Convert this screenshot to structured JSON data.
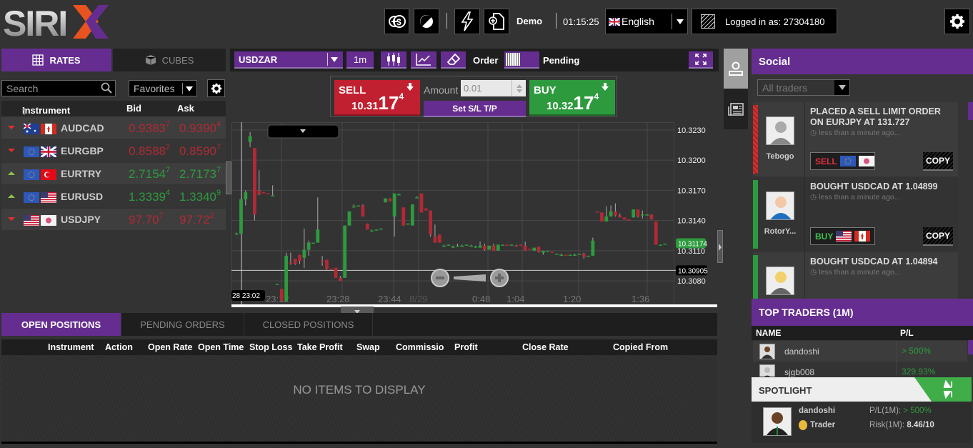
{
  "app": {
    "name": "SIRIX"
  },
  "topbar": {
    "mode": "Demo",
    "clock": "01:15:25",
    "language": "English",
    "logged_in": "Logged in as: 27304180",
    "buttons": [
      "deposit-icon",
      "theme-icon",
      "flash-icon",
      "new-document-icon"
    ]
  },
  "rates": {
    "tabs": {
      "rates": "RATES",
      "cubes": "CUBES"
    },
    "search_placeholder": "Search",
    "filter": "Favorites",
    "columns": {
      "instrument": "Instrument",
      "bid": "Bid",
      "ask": "Ask"
    },
    "rows": [
      {
        "symbol": "AUDCAD",
        "dir": "down",
        "bid": "0.9383",
        "bid_pip": "7",
        "ask": "0.9390",
        "ask_pip": "4",
        "flags": [
          "au",
          "ca"
        ]
      },
      {
        "symbol": "EURGBP",
        "dir": "down",
        "bid": "0.8588",
        "bid_pip": "2",
        "ask": "0.8590",
        "ask_pip": "7",
        "flags": [
          "eu",
          "gb"
        ]
      },
      {
        "symbol": "EURTRY",
        "dir": "up",
        "bid": "2.7154",
        "bid_pip": "7",
        "ask": "2.7173",
        "ask_pip": "7",
        "flags": [
          "eu",
          "tr"
        ]
      },
      {
        "symbol": "EURUSD",
        "dir": "up",
        "bid": "1.3339",
        "bid_pip": "4",
        "ask": "1.3340",
        "ask_pip": "9",
        "flags": [
          "eu",
          "us"
        ]
      },
      {
        "symbol": "USDJPY",
        "dir": "down",
        "bid": "97.70",
        "bid_pip": "7",
        "ask": "97.72",
        "ask_pip": "2",
        "flags": [
          "us",
          "jp"
        ]
      }
    ]
  },
  "chart_toolbar": {
    "symbol": "USDZAR",
    "timeframe": "1m",
    "order_label": "Order",
    "pending_label": "Pending"
  },
  "trade": {
    "sell_label": "SELL",
    "sell_price_main": "10.31",
    "sell_price_big": "17",
    "sell_price_pip": "4",
    "buy_label": "BUY",
    "buy_price_main": "10.32",
    "buy_price_big": "17",
    "buy_price_pip": "4",
    "amount_label": "Amount",
    "amount_value": "0.01",
    "sltp_label": "Set S/L T/P"
  },
  "chart_data": {
    "type": "candlestick",
    "symbol": "USDZAR",
    "y_ticks": [
      "10.3230",
      "10.3200",
      "10.3170",
      "10.3140",
      "10.3110",
      "10.3080"
    ],
    "ylim": [
      10.3068,
      10.3242
    ],
    "x_ticks": [
      "23:12",
      "23:28",
      "23:44",
      "8/29",
      "0:48",
      "1:04",
      "1:20",
      "1:36"
    ],
    "current_price": "10.31174",
    "crosshair_price": "10.30905",
    "crosshair_time": "28 23:02",
    "candles": [
      [
        10.3127,
        10.3128,
        10.3126,
        10.3127
      ],
      [
        10.3127,
        10.3162,
        10.3127,
        10.3161
      ],
      [
        10.3161,
        10.317,
        10.3155,
        10.3168
      ],
      [
        10.3218,
        10.3228,
        10.3213,
        10.3224
      ],
      [
        10.3212,
        10.3212,
        10.314,
        10.3146
      ],
      [
        10.317,
        10.319,
        10.3165,
        10.3166
      ],
      [
        10.3168,
        10.3168,
        10.3167,
        10.3167
      ],
      [
        10.3167,
        10.3167,
        10.3166,
        10.3166
      ],
      [
        10.3165,
        10.3175,
        10.3165,
        10.3165
      ],
      [
        10.3077,
        10.3077,
        10.3077,
        10.3077
      ],
      [
        10.3072,
        10.3072,
        10.306,
        10.306
      ],
      [
        10.306,
        10.3108,
        10.306,
        10.3105
      ],
      [
        10.3098,
        10.3108,
        10.3096,
        10.3097
      ],
      [
        10.3102,
        10.3102,
        10.3096,
        10.3097
      ],
      [
        10.3106,
        10.3106,
        10.3097,
        10.31
      ],
      [
        10.3103,
        10.3132,
        10.3093,
        10.3111
      ],
      [
        10.3111,
        10.312,
        10.3105,
        10.3118
      ],
      [
        10.3118,
        10.3118,
        10.3117,
        10.3118
      ],
      [
        10.3118,
        10.3163,
        10.3118,
        10.3131
      ],
      [
        10.31,
        10.3105,
        10.3095,
        10.3099
      ],
      [
        10.3101,
        10.3101,
        10.3091,
        10.3092
      ],
      [
        10.3092,
        10.3092,
        10.309,
        10.3091
      ],
      [
        10.3093,
        10.3093,
        10.3085,
        10.3083
      ],
      [
        10.3083,
        10.3085,
        10.308,
        10.308
      ],
      [
        10.3083,
        10.3135,
        10.3083,
        10.3135
      ],
      [
        10.3135,
        10.3149,
        10.3135,
        10.3149
      ],
      [
        10.3154,
        10.3156,
        10.3154,
        10.3154
      ],
      [
        10.3155,
        10.3155,
        10.3154,
        10.3155
      ],
      [
        10.3155,
        10.3156,
        10.3144,
        10.3144
      ],
      [
        10.3137,
        10.3137,
        10.3131,
        10.3131
      ],
      [
        10.313,
        10.3131,
        10.313,
        10.313
      ],
      [
        10.3131,
        10.3131,
        10.313,
        10.3131
      ],
      [
        10.3131,
        10.3132,
        10.3131,
        10.3132
      ],
      [
        10.3158,
        10.3162,
        10.3158,
        10.3162
      ],
      [
        10.3162,
        10.3162,
        10.3159,
        10.3159
      ],
      [
        10.3144,
        10.3167,
        10.3124,
        10.3167
      ],
      [
        10.3166,
        10.3167,
        10.3165,
        10.3166
      ],
      [
        10.3153,
        10.3153,
        10.3135,
        10.3135
      ],
      [
        10.3136,
        10.3137,
        10.3136,
        10.3137
      ],
      [
        10.3135,
        10.3156,
        10.3135,
        10.3156
      ],
      [
        10.3163,
        10.3164,
        10.3163,
        10.3163
      ],
      [
        10.3167,
        10.3167,
        10.3148,
        10.3148
      ],
      [
        10.3152,
        10.3152,
        10.315,
        10.315
      ],
      [
        10.315,
        10.315,
        10.3124,
        10.3126
      ],
      [
        10.3124,
        10.3136,
        10.3118,
        10.3118
      ],
      [
        10.3126,
        10.3126,
        10.3118,
        10.3118
      ],
      [
        10.3115,
        10.3116,
        10.3114,
        10.3115
      ],
      [
        10.3116,
        10.3116,
        10.3115,
        10.3116
      ],
      [
        10.3114,
        10.3115,
        10.3113,
        10.3114
      ],
      [
        10.3115,
        10.3117,
        10.3114,
        10.3115
      ],
      [
        10.3115,
        10.3116,
        10.3114,
        10.3115
      ],
      [
        10.3116,
        10.3116,
        10.3115,
        10.3116
      ],
      [
        10.3115,
        10.3116,
        10.3115,
        10.3115
      ],
      [
        10.3114,
        10.3115,
        10.3114,
        10.3114
      ],
      [
        10.3113,
        10.3119,
        10.3113,
        10.3115
      ],
      [
        10.3115,
        10.3117,
        10.311,
        10.3111
      ],
      [
        10.3111,
        10.3115,
        10.3111,
        10.3115
      ],
      [
        10.3115,
        10.3117,
        10.311,
        10.311
      ],
      [
        10.311,
        10.3115,
        10.311,
        10.3116
      ],
      [
        10.3116,
        10.3116,
        10.3115,
        10.3116
      ],
      [
        10.3116,
        10.3116,
        10.3115,
        10.3115
      ],
      [
        10.3116,
        10.3116,
        10.3115,
        10.3116
      ],
      [
        10.3115,
        10.3116,
        10.3114,
        10.3114
      ],
      [
        10.3116,
        10.3116,
        10.3115,
        10.3115
      ],
      [
        10.3115,
        10.3119,
        10.311,
        10.311
      ],
      [
        10.3112,
        10.3112,
        10.3111,
        10.3111
      ],
      [
        10.311,
        10.3113,
        10.311,
        10.3113
      ],
      [
        10.3114,
        10.3114,
        10.3108,
        10.3109
      ],
      [
        10.3108,
        10.311,
        10.3106,
        10.311
      ],
      [
        10.311,
        10.311,
        10.3109,
        10.311
      ],
      [
        10.3109,
        10.3109,
        10.3108,
        10.3108
      ],
      [
        10.3107,
        10.3107,
        10.3106,
        10.3107
      ],
      [
        10.3106,
        10.3107,
        10.3105,
        10.3106
      ],
      [
        10.3106,
        10.3106,
        10.3105,
        10.3105
      ],
      [
        10.3105,
        10.3106,
        10.3105,
        10.3106
      ],
      [
        10.3106,
        10.3107,
        10.3105,
        10.3106
      ],
      [
        10.3106,
        10.3107,
        10.3106,
        10.3107
      ],
      [
        10.3107,
        10.3108,
        10.3102,
        10.3104
      ],
      [
        10.3104,
        10.3105,
        10.3104,
        10.3105
      ],
      [
        10.3105,
        10.3123,
        10.3105,
        10.312
      ],
      [
        10.3149,
        10.3149,
        10.3148,
        10.3148
      ],
      [
        10.3148,
        10.3148,
        10.3139,
        10.3139
      ],
      [
        10.3139,
        10.3154,
        10.3139,
        10.3144
      ],
      [
        10.3144,
        10.3155,
        10.3144,
        10.3149
      ],
      [
        10.3149,
        10.3157,
        10.3144,
        10.3145
      ],
      [
        10.3145,
        10.3147,
        10.3143,
        10.3143
      ],
      [
        10.3143,
        10.3143,
        10.3141,
        10.3141
      ],
      [
        10.3141,
        10.3141,
        10.314,
        10.314
      ],
      [
        10.3143,
        10.3151,
        10.3143,
        10.3151
      ],
      [
        10.3151,
        10.3151,
        10.3143,
        10.3144
      ],
      [
        10.3146,
        10.315,
        10.3142,
        10.3146
      ],
      [
        10.3146,
        10.3146,
        10.3145,
        10.3146
      ],
      [
        10.3146,
        10.3146,
        10.3141,
        10.3141
      ],
      [
        10.3139,
        10.3139,
        10.3116,
        10.3116
      ],
      [
        10.3116,
        10.3116,
        10.3115,
        10.3116
      ],
      [
        10.3117,
        10.3117,
        10.3116,
        10.3117
      ]
    ]
  },
  "positions": {
    "tabs": [
      "OPEN POSITIONS",
      "PENDING ORDERS",
      "CLOSED POSITIONS"
    ],
    "columns": [
      "Instrument",
      "Action",
      "Open Rate",
      "Open Time",
      "Stop Loss",
      "Take Profit",
      "Swap",
      "Commissio",
      "Profit",
      "Close Rate",
      "Copied From"
    ],
    "empty_text": "NO ITEMS TO DISPLAY"
  },
  "social": {
    "title": "Social",
    "filter_placeholder": "All traders",
    "feed": [
      {
        "user": "Tebogo",
        "side": "sell",
        "message": "PLACED A SELL LIMIT ORDER ON EURJPY AT 131.727",
        "time": "less than a minute ago...",
        "action": "SELL",
        "flags": [
          "eu",
          "jp"
        ],
        "copy": "COPY"
      },
      {
        "user": "RotorY...",
        "side": "buy",
        "message": "BOUGHT USDCAD AT 1.04899",
        "time": "less than a minute ago...",
        "action": "BUY",
        "flags": [
          "us",
          "ca"
        ],
        "copy": "COPY"
      },
      {
        "user": "",
        "side": "buy",
        "message": "BOUGHT USDCAD AT 1.04894",
        "time": "less than a minute ago..."
      }
    ]
  },
  "top_traders": {
    "title": "TOP TRADERS (1M)",
    "columns": {
      "name": "NAME",
      "pl": "P/L"
    },
    "rows": [
      {
        "name": "dandoshi",
        "pl": "> 500%"
      },
      {
        "name": "sjgb008",
        "pl": "329.93%"
      }
    ]
  },
  "spotlight": {
    "title": "SPOTLIGHT",
    "name": "dandoshi",
    "role": "Trader",
    "pl_label": "P/L(1M):",
    "pl_value": "> 500%",
    "risk_label": "Risk(1M):",
    "risk_value": "8.46/10"
  },
  "colors": {
    "accent": "#662d91",
    "sell": "#c0202f",
    "buy": "#2e9a3e",
    "background": "#333333"
  }
}
